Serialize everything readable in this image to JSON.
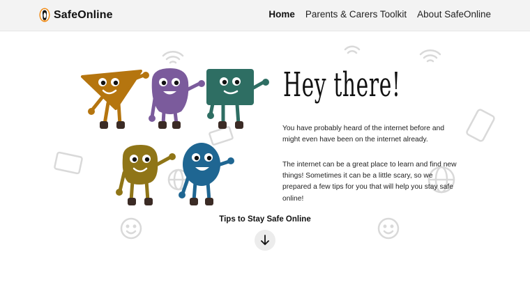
{
  "header": {
    "logo_text": "SafeOnline",
    "logo_icon": "penguin-icon",
    "nav": [
      {
        "label": "Home",
        "active": true
      },
      {
        "label": "Parents & Carers Toolkit",
        "active": false
      },
      {
        "label": "About SafeOnline",
        "active": false
      }
    ]
  },
  "hero": {
    "title": "Hey there!",
    "paragraphs": [
      "You have probably heard of the internet before and might even have been on the internet already.",
      "The internet can be a great place to learn and find new things! Sometimes it can be a little scary, so we prepared a few tips for you that will help you stay safe online!"
    ]
  },
  "tips": {
    "label": "Tips to Stay Safe Online",
    "scroll_icon": "arrow-down-icon"
  },
  "colors": {
    "orange": "#B5750F",
    "purple": "#7B5B9C",
    "teal": "#2E6E63",
    "mustard": "#8F7517",
    "blue": "#1F6692",
    "header_bg": "#f3f3f3"
  }
}
